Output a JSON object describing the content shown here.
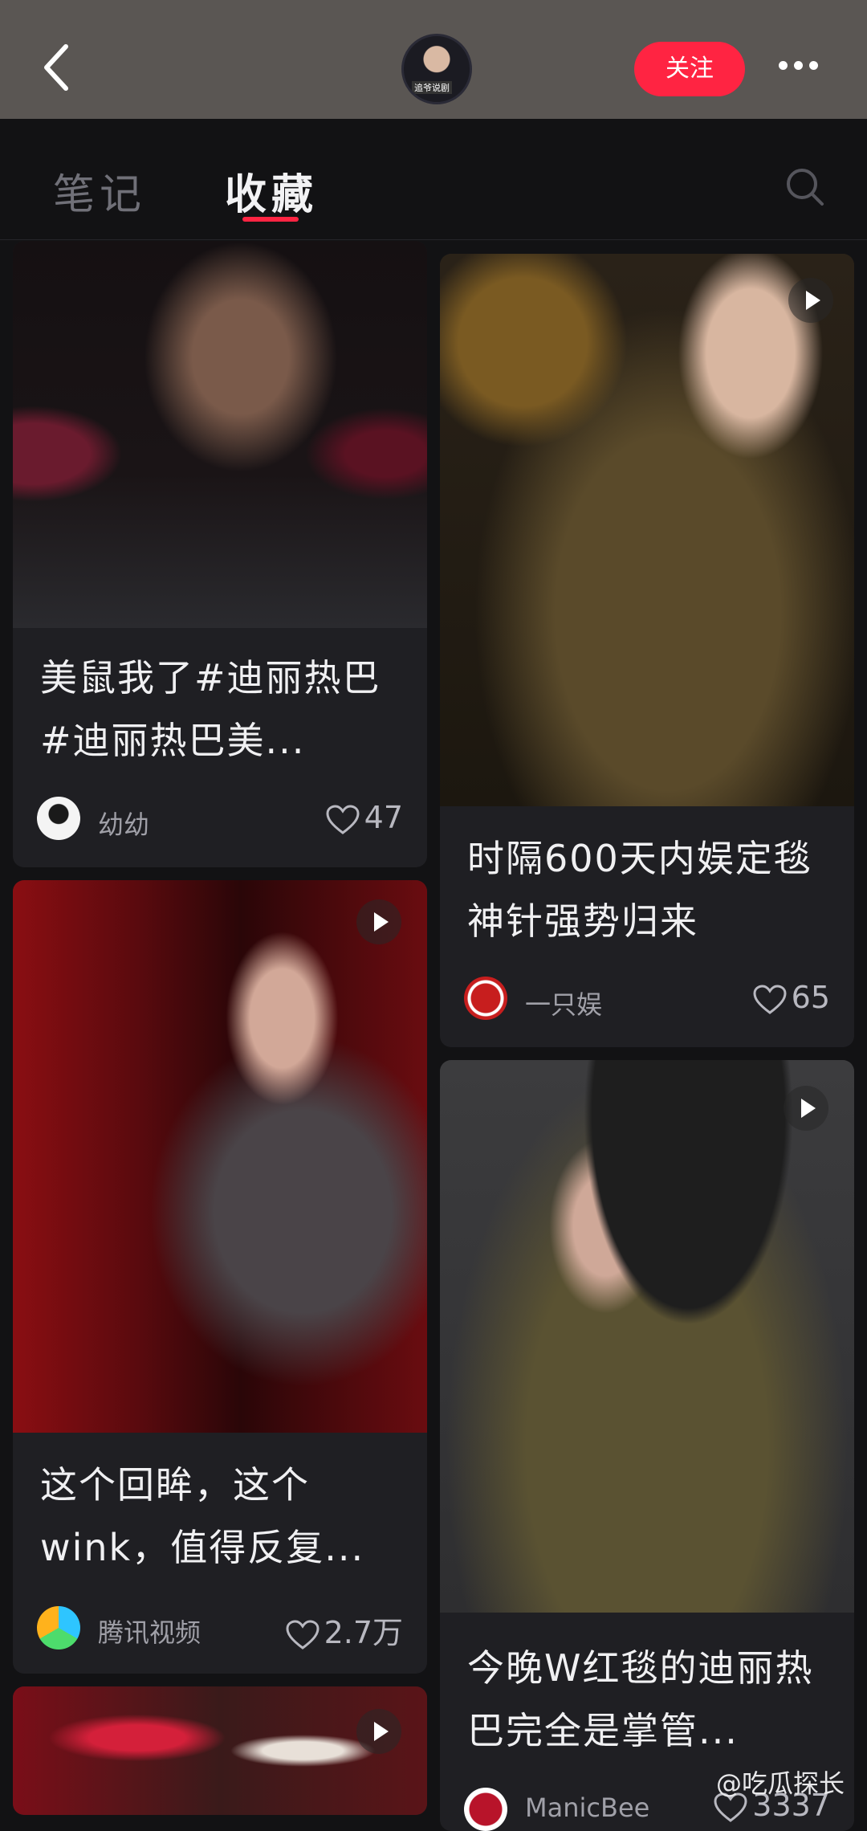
{
  "header": {
    "avatar_caption": "追爷说剧",
    "follow_label": "关注"
  },
  "tabs": [
    {
      "label": "笔记"
    },
    {
      "label": "收藏"
    }
  ],
  "cards": [
    {
      "title": "美鼠我了#迪丽热巴 #迪丽热巴美...",
      "author": "幼幼",
      "likes": "47"
    },
    {
      "title": "时隔600天内娱定毯神针强势归来",
      "author": "一只娱",
      "likes": "65"
    },
    {
      "title": "这个回眸，这个wink，值得反复...",
      "author": "腾讯视频",
      "likes": "2.7万"
    },
    {
      "title": "今晚W红毯的迪丽热巴完全是掌管...",
      "author": "ManicBee",
      "likes": "3337"
    }
  ],
  "watermark": "@吃瓜探长",
  "colors": {
    "accent": "#ff2442",
    "background": "#121214",
    "card": "#1f1f23"
  }
}
